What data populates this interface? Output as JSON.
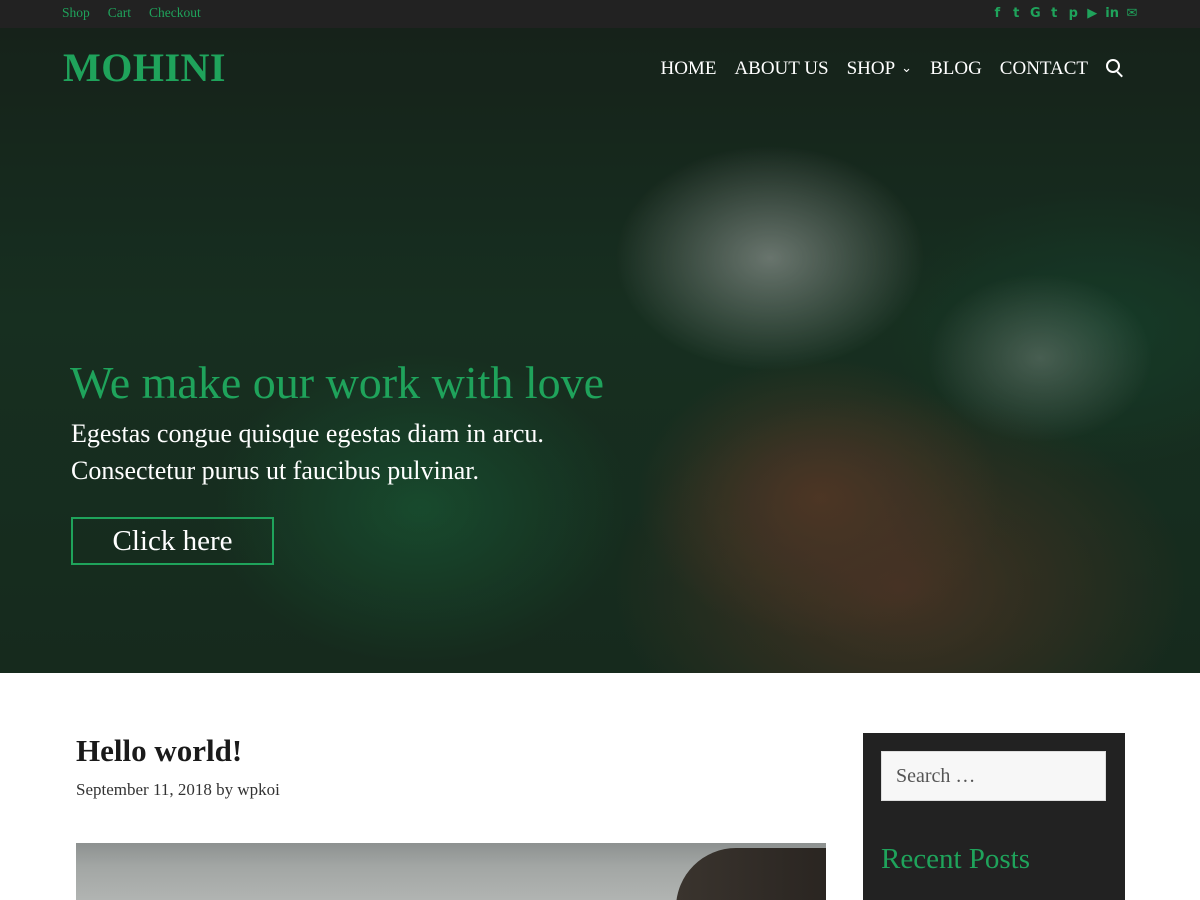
{
  "topbar": {
    "links": [
      "Shop",
      "Cart",
      "Checkout"
    ],
    "social_icons": [
      "facebook-icon",
      "twitter-icon",
      "google-icon",
      "tumblr-icon",
      "pinterest-icon",
      "youtube-icon",
      "linkedin-icon",
      "email-icon"
    ],
    "social_glyphs": [
      "f",
      "t",
      "G",
      "t",
      "p",
      "▶",
      "in",
      "✉"
    ]
  },
  "header": {
    "logo": "MOHINI",
    "nav": [
      "HOME",
      "ABOUT US",
      "SHOP",
      "BLOG",
      "CONTACT"
    ],
    "shop_chevron": "⌄"
  },
  "hero": {
    "title": "We make our work with love",
    "line1": "Egestas congue quisque egestas diam in arcu.",
    "line2": "Consectetur purus ut faucibus pulvinar.",
    "button": "Click here"
  },
  "post": {
    "title": "Hello world!",
    "date": "September 11, 2018",
    "by": "by",
    "author": "wpkoi"
  },
  "sidebar": {
    "search_placeholder": "Search …",
    "recent_posts_title": "Recent Posts"
  },
  "colors": {
    "accent": "#1fa35b",
    "topbar_bg": "#222222",
    "sidebar_bg": "#222222"
  }
}
